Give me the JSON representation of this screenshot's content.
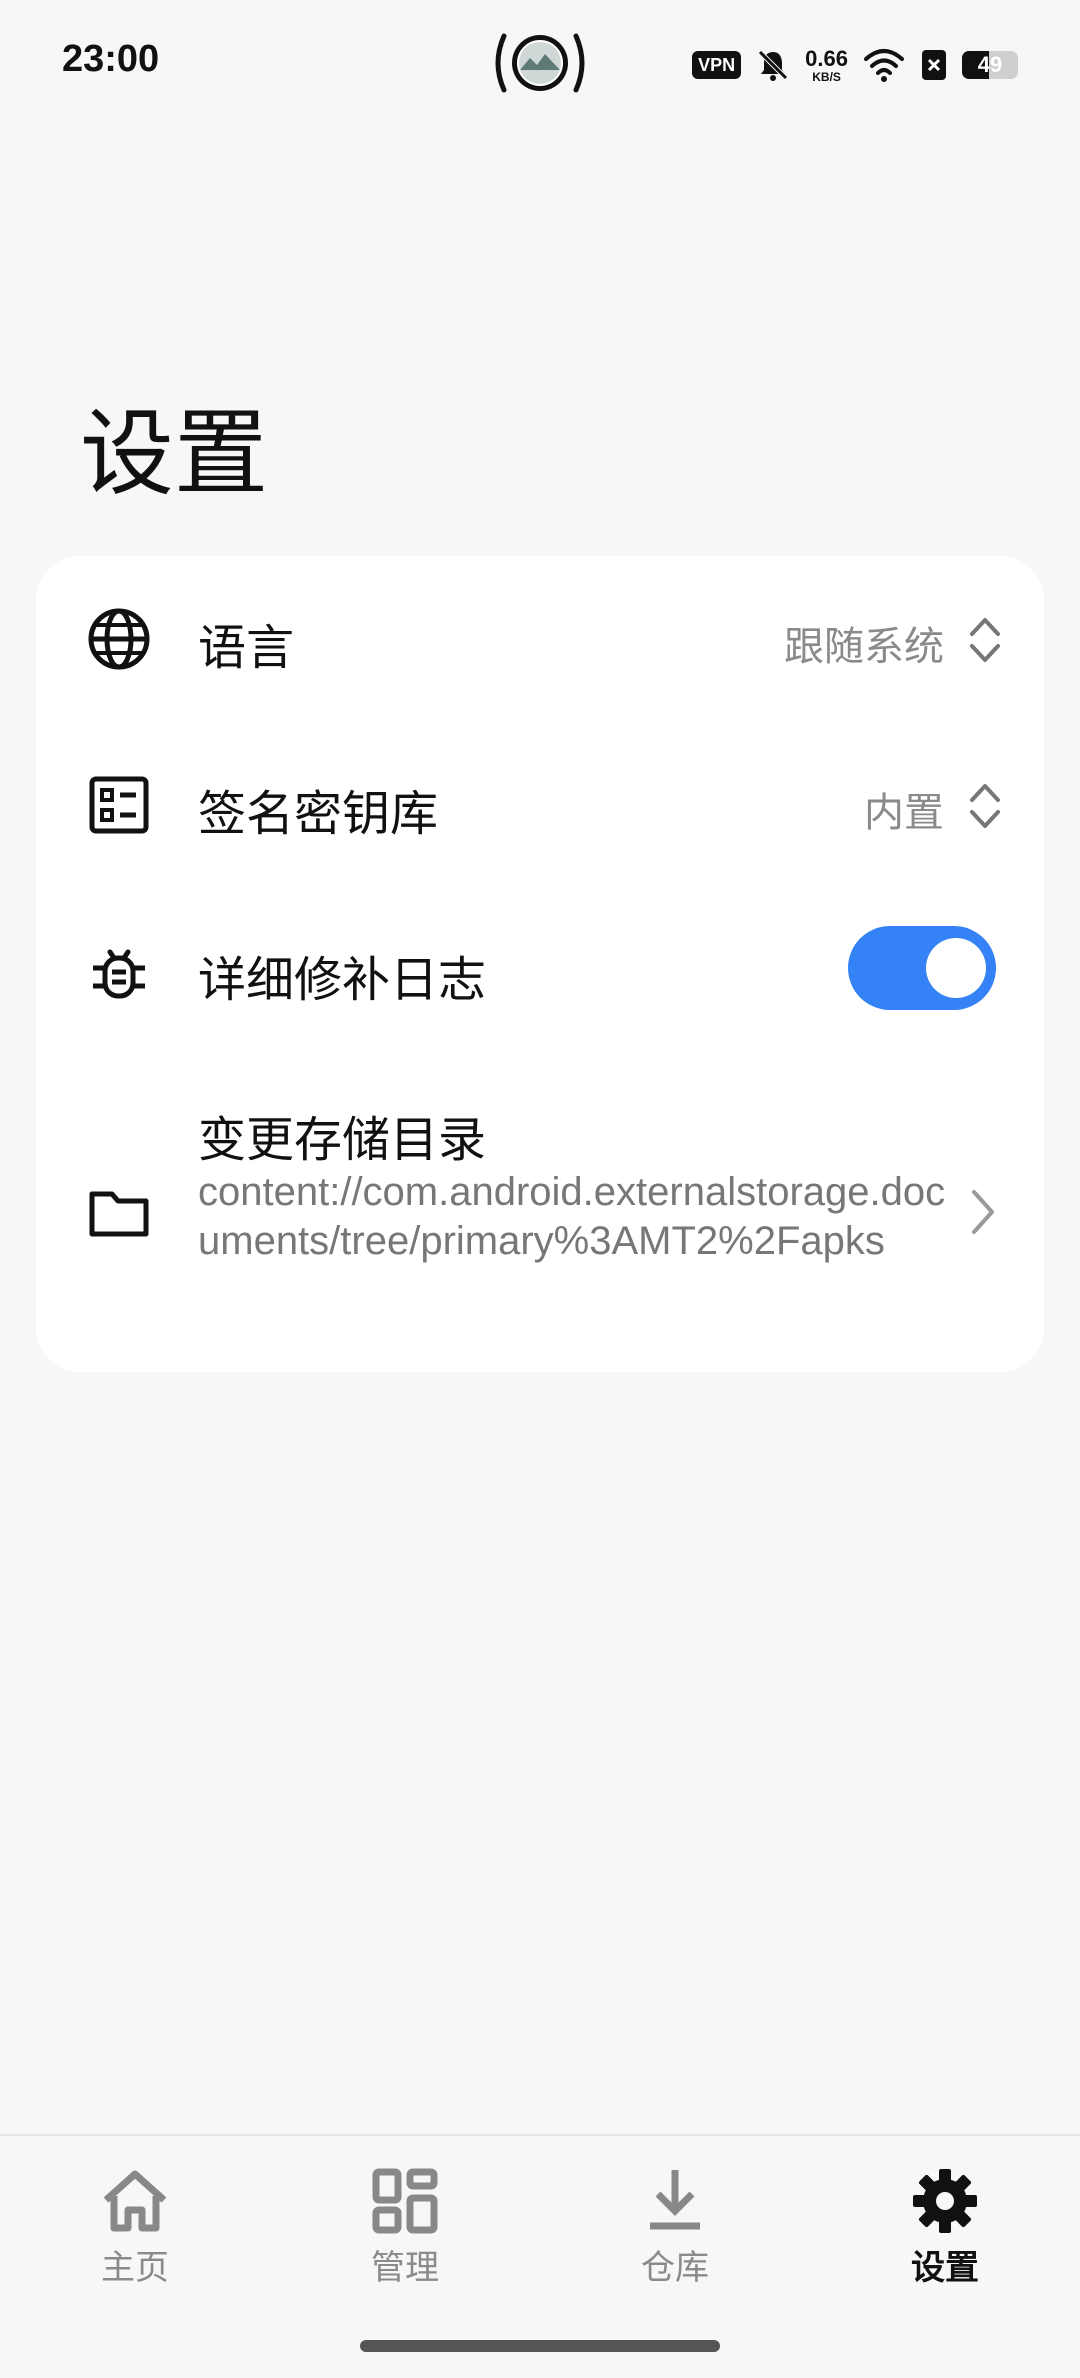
{
  "status_bar": {
    "time": "23:00",
    "vpn": "VPN",
    "net_speed_value": "0.66",
    "net_speed_unit": "KB/S",
    "battery_level": "49",
    "battery_fraction": 0.49
  },
  "page": {
    "title": "设置"
  },
  "settings": {
    "language": {
      "label": "语言",
      "value": "跟随系统",
      "icon": "globe-icon"
    },
    "keystore": {
      "label": "签名密钥库",
      "value": "内置",
      "icon": "keystore-icon"
    },
    "verbose_log": {
      "label": "详细修补日志",
      "enabled": true,
      "icon": "bug-icon"
    },
    "storage_dir": {
      "label": "变更存储目录",
      "path": "content://com.android.externalstorage.documents/tree/primary%3AMT2%2Fapks",
      "icon": "folder-icon"
    }
  },
  "nav": {
    "items": [
      {
        "label": "主页",
        "icon": "home-icon",
        "active": false
      },
      {
        "label": "管理",
        "icon": "manage-grid-icon",
        "active": false
      },
      {
        "label": "仓库",
        "icon": "download-icon",
        "active": false
      },
      {
        "label": "设置",
        "icon": "gear-icon",
        "active": true
      }
    ]
  },
  "colors": {
    "accent": "#3482f6",
    "background": "#f7f7f7",
    "card": "#ffffff",
    "secondary_text": "#8a8a8a"
  }
}
